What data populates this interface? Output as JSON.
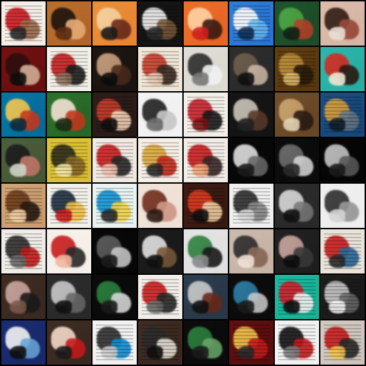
{
  "tiles": [
    {
      "bg": "#f4eee6",
      "c1": "#c9151c",
      "c2": "#9b6a4a",
      "c3": "#2a2a2a",
      "lines": true
    },
    {
      "bg": "#b26a2e",
      "c1": "#1b120d",
      "c2": "#e6b07a",
      "c3": "#5a2b14",
      "lines": false
    },
    {
      "bg": "#e58b3a",
      "c1": "#f3cf9a",
      "c2": "#6a2b1b",
      "c3": "#1b1b1b",
      "lines": false
    },
    {
      "bg": "#141414",
      "c1": "#f2f2f2",
      "c2": "#7b5a3a",
      "c3": "#2c2c2c",
      "lines": true
    },
    {
      "bg": "#e46a2a",
      "c1": "#ffd0a2",
      "c2": "#3a1b12",
      "c3": "#cf1e1e",
      "lines": false
    },
    {
      "bg": "#2f78cf",
      "c1": "#ffffff",
      "c2": "#6bb9f0",
      "c3": "#0f2d55",
      "lines": true
    },
    {
      "bg": "#1f4e2a",
      "c1": "#4aa341",
      "c2": "#b2422a",
      "c3": "#102014",
      "lines": false
    },
    {
      "bg": "#d8b8a8",
      "c1": "#2e1b14",
      "c2": "#9a4a3a",
      "c3": "#e9e0d5",
      "lines": false
    },
    {
      "bg": "#6a1010",
      "c1": "#2b0d0d",
      "c2": "#d2b29b",
      "c3": "#0c0c0c",
      "lines": false
    },
    {
      "bg": "#f1efe8",
      "c1": "#c21b1b",
      "c2": "#1e1e1e",
      "c3": "#8b6d5a",
      "lines": true
    },
    {
      "bg": "#1b1410",
      "c1": "#c69c7a",
      "c2": "#4a2b1c",
      "c3": "#0c0c0c",
      "lines": false
    },
    {
      "bg": "#efe6d8",
      "c1": "#c23a2a",
      "c2": "#3a2a22",
      "c3": "#e4c7b0",
      "lines": true
    },
    {
      "bg": "#dedbd4",
      "c1": "#2a2a2a",
      "c2": "#f2f2f2",
      "c3": "#7a7a7a",
      "lines": false
    },
    {
      "bg": "#2b2b2b",
      "c1": "#6b5a4a",
      "c2": "#c9b7a3",
      "c3": "#0f0f0f",
      "lines": false
    },
    {
      "bg": "#5a3a12",
      "c1": "#b98a3a",
      "c2": "#2a1a0a",
      "c3": "#d7b56a",
      "lines": true
    },
    {
      "bg": "#2fb0a6",
      "c1": "#d1281e",
      "c2": "#2a1a12",
      "c3": "#f2e7d5",
      "lines": false
    },
    {
      "bg": "#0a6f9b",
      "c1": "#f2c34a",
      "c2": "#c63a1e",
      "c3": "#0b2a3a",
      "lines": false
    },
    {
      "bg": "#2b6a2a",
      "c1": "#f2e1d2",
      "c2": "#c23a1e",
      "c3": "#1a2a12",
      "lines": false
    },
    {
      "bg": "#2a1c18",
      "c1": "#c23a2a",
      "c2": "#f1d1b6",
      "c3": "#0f0f0f",
      "lines": true
    },
    {
      "bg": "#f2f2f2",
      "c1": "#1e1e1e",
      "c2": "#c9c9c9",
      "c3": "#6b6b6b",
      "lines": false
    },
    {
      "bg": "#f3efe8",
      "c1": "#c41f2a",
      "c2": "#1a1a1a",
      "c3": "#7a1414",
      "lines": true
    },
    {
      "bg": "#141414",
      "c1": "#c7c0b5",
      "c2": "#5a3a2a",
      "c3": "#222222",
      "lines": false
    },
    {
      "bg": "#6a4a2a",
      "c1": "#c6a06a",
      "c2": "#2a1a12",
      "c3": "#e3d2b6",
      "lines": false
    },
    {
      "bg": "#1a4a7a",
      "c1": "#d69a3a",
      "c2": "#6a7a8a",
      "c3": "#0f1c2a",
      "lines": true
    },
    {
      "bg": "#4a5a3a",
      "c1": "#1a1a1a",
      "c2": "#c27a6a",
      "c3": "#cfd6c6",
      "lines": false
    },
    {
      "bg": "#d9c03a",
      "c1": "#2a2a1a",
      "c2": "#8b6a2a",
      "c3": "#f2e6a6",
      "lines": true
    },
    {
      "bg": "#f1e9e2",
      "c1": "#c61b1b",
      "c2": "#2a2a2a",
      "c3": "#f0c0b0",
      "lines": true
    },
    {
      "bg": "#f5efe7",
      "c1": "#d6a43a",
      "c2": "#c32a1e",
      "c3": "#2a2a2a",
      "lines": true
    },
    {
      "bg": "#f1ece6",
      "c1": "#c61b1b",
      "c2": "#3a2a2a",
      "c3": "#f2a67a",
      "lines": true
    },
    {
      "bg": "#070707",
      "c1": "#dcdcdc",
      "c2": "#6a6a6a",
      "c3": "#1a1a1a",
      "lines": false
    },
    {
      "bg": "#0b0b0b",
      "c1": "#6a6a6a",
      "c2": "#d2d2d2",
      "c3": "#2a2a2a",
      "lines": false
    },
    {
      "bg": "#050505",
      "c1": "#c1c1c1",
      "c2": "#5a5a5a",
      "c3": "#1a1a1a",
      "lines": false
    },
    {
      "bg": "#caa074",
      "c1": "#6a3a1a",
      "c2": "#2a1a12",
      "c3": "#f0d0a6",
      "lines": true
    },
    {
      "bg": "#f2f0ea",
      "c1": "#1a2a3a",
      "c2": "#f2c24a",
      "c3": "#c61b1b",
      "lines": true
    },
    {
      "bg": "#e9f3f2",
      "c1": "#0e8fd1",
      "c2": "#f2d44a",
      "c3": "#2a2a2a",
      "lines": true
    },
    {
      "bg": "#efe2d8",
      "c1": "#6a2a1a",
      "c2": "#d19a8a",
      "c3": "#2a1a12",
      "lines": false
    },
    {
      "bg": "#3a1a12",
      "c1": "#d73a1e",
      "c2": "#f0d0a6",
      "c3": "#0f0f0f",
      "lines": true
    },
    {
      "bg": "#f0f0f0",
      "c1": "#2a2a2a",
      "c2": "#8a8a8a",
      "c3": "#d5d5d5",
      "lines": true
    },
    {
      "bg": "#2a2a2a",
      "c1": "#d6d6d6",
      "c2": "#7a7a7a",
      "c3": "#0f0f0f",
      "lines": false
    },
    {
      "bg": "#efefef",
      "c1": "#2a2a2a",
      "c2": "#9a9a9a",
      "c3": "#d5d5d5",
      "lines": false
    },
    {
      "bg": "#f0ede8",
      "c1": "#2a2a2a",
      "c2": "#c61b1b",
      "c3": "#6a6a6a",
      "lines": true
    },
    {
      "bg": "#f6f0ea",
      "c1": "#c61b1b",
      "c2": "#2a2a2a",
      "c3": "#f2b7a0",
      "lines": false
    },
    {
      "bg": "#070707",
      "c1": "#5a5a5a",
      "c2": "#c6c6c6",
      "c3": "#1a1a1a",
      "lines": false
    },
    {
      "bg": "#1a1a1a",
      "c1": "#e0e0e0",
      "c2": "#7a5a3a",
      "c3": "#0f0f0f",
      "lines": false
    },
    {
      "bg": "#e2e2e2",
      "c1": "#2a7a3a",
      "c2": "#1a1a1a",
      "c3": "#8a8a8a",
      "lines": false
    },
    {
      "bg": "#c7b7aa",
      "c1": "#2a2a2a",
      "c2": "#8a6a5a",
      "c3": "#f0e2d6",
      "lines": false
    },
    {
      "bg": "#1f1f1f",
      "c1": "#c7a19a",
      "c2": "#3a3a3a",
      "c3": "#0c0c0c",
      "lines": false
    },
    {
      "bg": "#e9e3da",
      "c1": "#c61b1b",
      "c2": "#2a6a9a",
      "c3": "#2a2a2a",
      "lines": true
    },
    {
      "bg": "#3a2a22",
      "c1": "#c7a19a",
      "c2": "#1a1a1a",
      "c3": "#7a5a4a",
      "lines": false
    },
    {
      "bg": "#2a2a2a",
      "c1": "#c6c6c6",
      "c2": "#6a6a6a",
      "c3": "#0f0f0f",
      "lines": false
    },
    {
      "bg": "#0a0a0a",
      "c1": "#2a7a3a",
      "c2": "#d6d6d6",
      "c3": "#1a1a1a",
      "lines": false
    },
    {
      "bg": "#f2eeea",
      "c1": "#c61b1b",
      "c2": "#2a2a2a",
      "c3": "#6a6a6a",
      "lines": true
    },
    {
      "bg": "#2a3a4a",
      "c1": "#c6c6c6",
      "c2": "#6a2a1a",
      "c3": "#0f0f0f",
      "lines": false
    },
    {
      "bg": "#0b0b0b",
      "c1": "#2b7aa3",
      "c2": "#c6c6c6",
      "c3": "#1a1a1a",
      "lines": false
    },
    {
      "bg": "#1fb39a",
      "c1": "#d11b2a",
      "c2": "#f2f2f2",
      "c3": "#0f0f0f",
      "lines": true
    },
    {
      "bg": "#1b1b1b",
      "c1": "#c6c6c6",
      "c2": "#6a6a6a",
      "c3": "#f2f2f2",
      "lines": true
    },
    {
      "bg": "#1a2a6a",
      "c1": "#f2f2f2",
      "c2": "#6aa6d6",
      "c3": "#0f0f0f",
      "lines": false
    },
    {
      "bg": "#3a2a22",
      "c1": "#f2d6c6",
      "c2": "#c61b1b",
      "c3": "#1a1a1a",
      "lines": false
    },
    {
      "bg": "#f2f2f2",
      "c1": "#2a2a2a",
      "c2": "#0e8fd1",
      "c3": "#c9c9c9",
      "lines": true
    },
    {
      "bg": "#3a2a22",
      "c1": "#2a2a2a",
      "c2": "#e6e0d6",
      "c3": "#0f0f0f",
      "lines": true
    },
    {
      "bg": "#0b0b0b",
      "c1": "#2a7a3a",
      "c2": "#6aa66a",
      "c3": "#1a1a1a",
      "lines": false
    },
    {
      "bg": "#5a0f0f",
      "c1": "#f2c24a",
      "c2": "#c61b1b",
      "c3": "#2a2a2a",
      "lines": true
    },
    {
      "bg": "#f2f2f2",
      "c1": "#0f0f0f",
      "c2": "#c61b1b",
      "c3": "#7a7a7a",
      "lines": true
    },
    {
      "bg": "#cfc7bf",
      "c1": "#c61b1b",
      "c2": "#2a2a2a",
      "c3": "#f2c24a",
      "lines": true
    }
  ]
}
